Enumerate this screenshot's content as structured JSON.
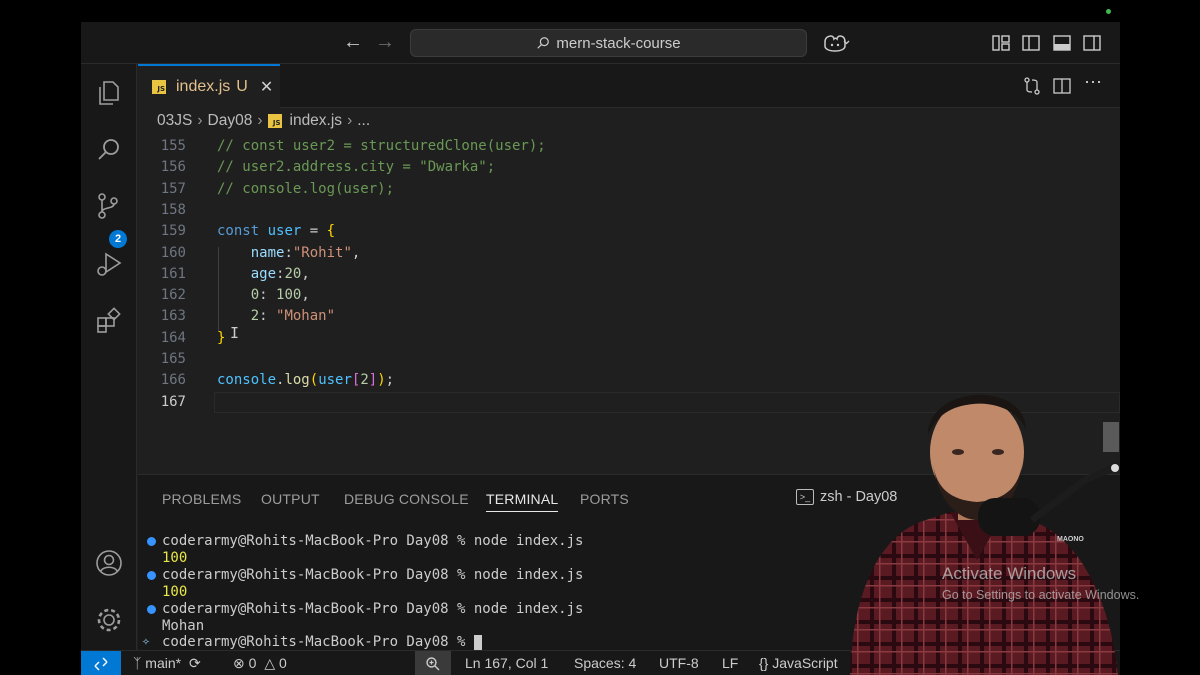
{
  "window": {
    "search_text": "mern-stack-course"
  },
  "tab": {
    "filename": "index.js",
    "status": "U",
    "icon_text": "JS"
  },
  "breadcrumb": {
    "parts": [
      "03JS",
      "Day08",
      "index.js",
      "..."
    ]
  },
  "activity": {
    "scm_badge": "2"
  },
  "editor": {
    "current_line": 167,
    "lines": [
      {
        "n": "155",
        "tokens": [
          {
            "t": "// const user2 = structuredClone(user);",
            "c": "cm"
          }
        ]
      },
      {
        "n": "156",
        "tokens": [
          {
            "t": "// user2.address.city = \"Dwarka\";",
            "c": "cm"
          }
        ]
      },
      {
        "n": "157",
        "tokens": [
          {
            "t": "// console.log(user);",
            "c": "cm"
          }
        ]
      },
      {
        "n": "158",
        "tokens": []
      },
      {
        "n": "159",
        "tokens": [
          {
            "t": "const",
            "c": "kw"
          },
          {
            "t": " ",
            "c": "pun"
          },
          {
            "t": "user",
            "c": "var"
          },
          {
            "t": " = ",
            "c": "pun"
          },
          {
            "t": "{",
            "c": "br1"
          }
        ]
      },
      {
        "n": "160",
        "tokens": [
          {
            "t": "    ",
            "c": "pun"
          },
          {
            "t": "name",
            "c": "prop"
          },
          {
            "t": ":",
            "c": "pun"
          },
          {
            "t": "\"Rohit\"",
            "c": "str"
          },
          {
            "t": ",",
            "c": "pun"
          }
        ]
      },
      {
        "n": "161",
        "tokens": [
          {
            "t": "    ",
            "c": "pun"
          },
          {
            "t": "age",
            "c": "prop"
          },
          {
            "t": ":",
            "c": "pun"
          },
          {
            "t": "20",
            "c": "num"
          },
          {
            "t": ",",
            "c": "pun"
          }
        ]
      },
      {
        "n": "162",
        "tokens": [
          {
            "t": "    ",
            "c": "pun"
          },
          {
            "t": "0",
            "c": "num"
          },
          {
            "t": ": ",
            "c": "pun"
          },
          {
            "t": "100",
            "c": "num"
          },
          {
            "t": ",",
            "c": "pun"
          }
        ]
      },
      {
        "n": "163",
        "tokens": [
          {
            "t": "    ",
            "c": "pun"
          },
          {
            "t": "2",
            "c": "num"
          },
          {
            "t": ": ",
            "c": "pun"
          },
          {
            "t": "\"Mohan\"",
            "c": "str"
          }
        ]
      },
      {
        "n": "164",
        "tokens": [
          {
            "t": "}",
            "c": "br1"
          }
        ]
      },
      {
        "n": "165",
        "tokens": []
      },
      {
        "n": "166",
        "tokens": [
          {
            "t": "console",
            "c": "var"
          },
          {
            "t": ".",
            "c": "pun"
          },
          {
            "t": "log",
            "c": "fn"
          },
          {
            "t": "(",
            "c": "br1"
          },
          {
            "t": "user",
            "c": "var"
          },
          {
            "t": "[",
            "c": "br2"
          },
          {
            "t": "2",
            "c": "num"
          },
          {
            "t": "]",
            "c": "br2"
          },
          {
            "t": ")",
            "c": "br1"
          },
          {
            "t": ";",
            "c": "pun"
          }
        ]
      },
      {
        "n": "167",
        "tokens": []
      }
    ]
  },
  "panel": {
    "tabs": [
      "PROBLEMS",
      "OUTPUT",
      "DEBUG CONSOLE",
      "TERMINAL",
      "PORTS"
    ],
    "active_tab": "TERMINAL",
    "terminal_name": "zsh - Day08"
  },
  "terminal": {
    "lines": [
      {
        "text": "coderarmy@Rohits-MacBook-Pro Day08 % node index.js",
        "kind": "prompt"
      },
      {
        "text": "100",
        "kind": "out-yellow"
      },
      {
        "text": "coderarmy@Rohits-MacBook-Pro Day08 % node index.js",
        "kind": "prompt"
      },
      {
        "text": "100",
        "kind": "out-yellow"
      },
      {
        "text": "coderarmy@Rohits-MacBook-Pro Day08 % node index.js",
        "kind": "prompt"
      },
      {
        "text": "Mohan",
        "kind": "out"
      },
      {
        "text": "coderarmy@Rohits-MacBook-Pro Day08 % ",
        "kind": "current"
      }
    ]
  },
  "statusbar": {
    "branch": "main*",
    "errors": "0",
    "warnings": "0",
    "position": "Ln 167, Col 1",
    "spaces": "Spaces: 4",
    "encoding": "UTF-8",
    "eol": "LF",
    "language": "JavaScript"
  },
  "overlay": {
    "watermark_title": "Activate Windows",
    "watermark_sub": "Go to Settings to activate Windows."
  },
  "colors": {
    "accent": "#0078d4",
    "editor_bg": "#1f1f1f",
    "chrome_bg": "#181818",
    "tab_modified": "#e2c08d",
    "comment": "#6a9955",
    "keyword": "#569cd6",
    "string": "#ce9178",
    "number": "#b5cea8"
  }
}
